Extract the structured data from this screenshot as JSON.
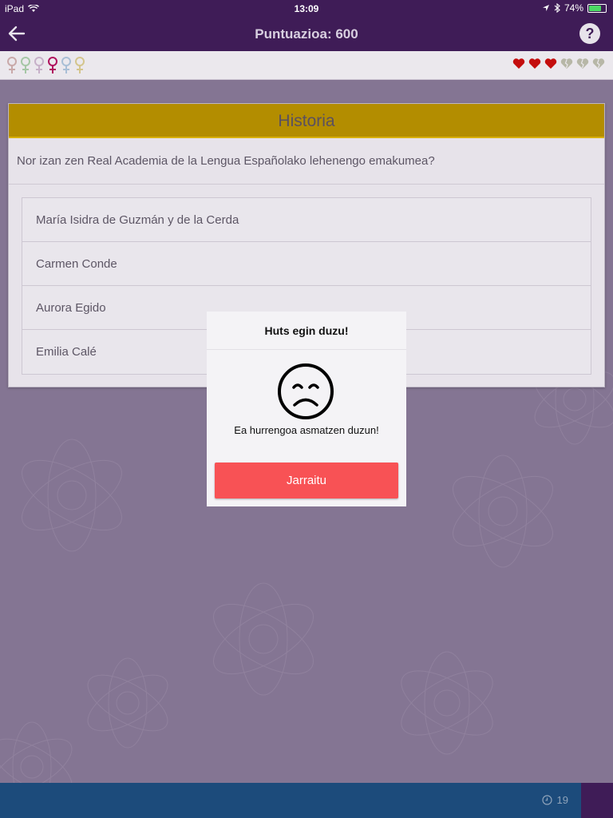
{
  "status_bar": {
    "device": "iPad",
    "time": "13:09",
    "battery": "74%",
    "battery_level": 0.74
  },
  "nav": {
    "title": "Puntuazioa: 600",
    "back_icon": "arrow-left-icon",
    "help_label": "?"
  },
  "progress": {
    "symbols": [
      "female-symbol-icon",
      "female-symbol-icon",
      "female-symbol-icon",
      "female-symbol-icon",
      "female-symbol-icon",
      "female-symbol-icon"
    ],
    "symbol_colors": [
      "#c9a9a9",
      "#a6c7a6",
      "#c7b1c9",
      "#b0125e",
      "#a9bfd6",
      "#d4c58d"
    ],
    "lives": {
      "full": 3,
      "total": 6
    }
  },
  "question_card": {
    "category": "Historia",
    "question": "Nor izan zen Real Academia de la Lengua Españolako lehenengo emakumea?",
    "answers": [
      "María Isidra de Guzmán y de la Cerda",
      "Carmen Conde",
      "Aurora Egido",
      "Emilia Calé"
    ]
  },
  "modal": {
    "title": "Huts egin duzu!",
    "icon": "sad-face-icon",
    "message": "Ea hurrengoa asmatzen duzun!",
    "button_label": "Jarraitu"
  },
  "bottom_bar": {
    "timer_icon": "clock-icon",
    "timer_value": "19"
  },
  "colors": {
    "nav_bg": "#3f1c57",
    "category_header": "#b38d00",
    "modal_button": "#f85255",
    "bottom_bar": "#1c4b7b",
    "heart_full": "#c40d0d",
    "heart_empty": "#b7b7a7"
  }
}
